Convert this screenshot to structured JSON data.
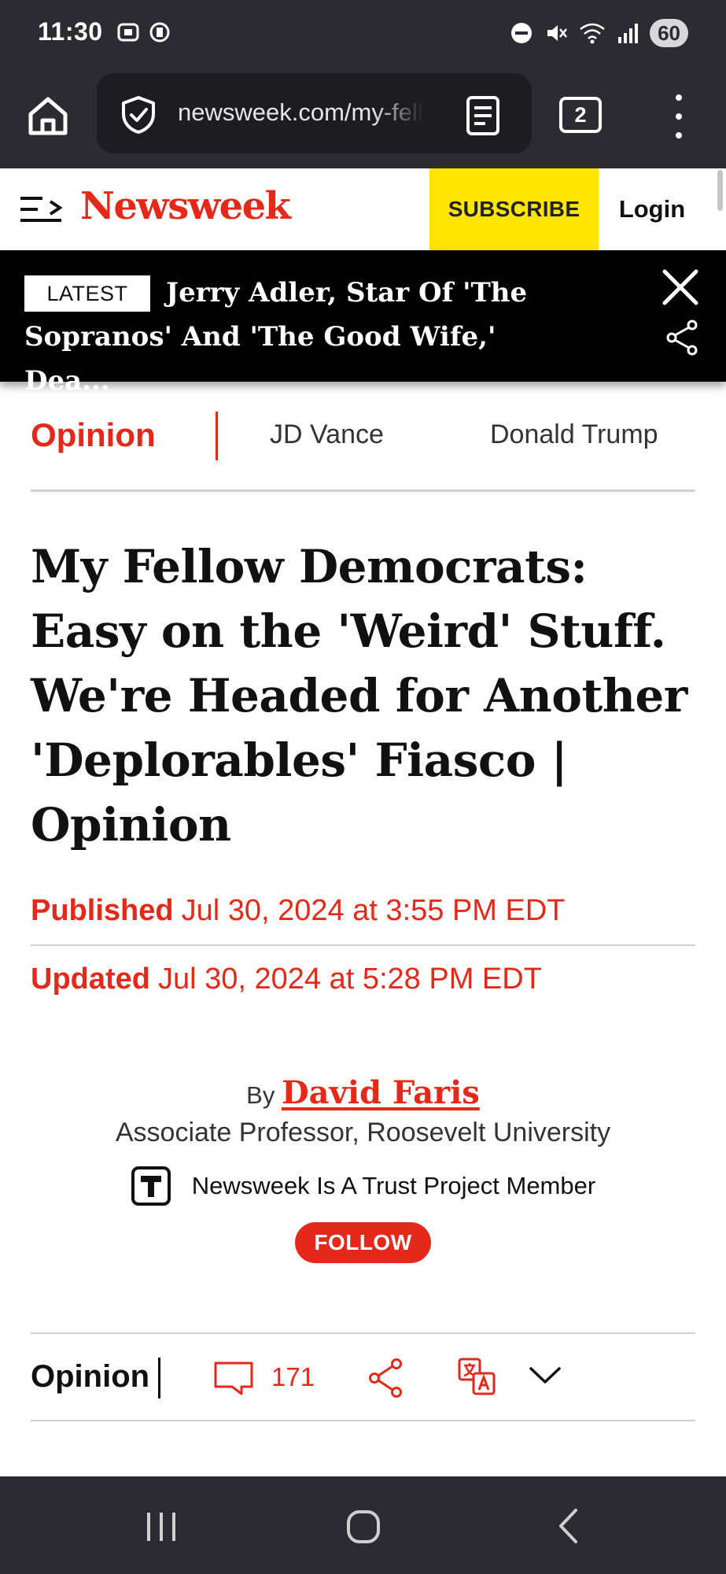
{
  "status_bar": {
    "time": "11:30",
    "battery": "60"
  },
  "browser": {
    "url": "newsweek.com/my-fellow-democrats",
    "tab_count": "2"
  },
  "site_header": {
    "logo": "Newsweek",
    "subscribe_label": "SUBSCRIBE",
    "login_label": "Login"
  },
  "latest_banner": {
    "badge": "LATEST",
    "headline": "Jerry Adler, Star Of 'The Sopranos' And 'The Good Wife,' Dea..."
  },
  "topic_nav": {
    "section": "Opinion",
    "topics": [
      "JD Vance",
      "Donald Trump"
    ]
  },
  "article": {
    "headline": "My Fellow Democrats: Easy on the 'Weird' Stuff. We're Headed for Another 'Deplorables' Fiasco | Opinion",
    "published_label": "Published",
    "published_date": "Jul 30, 2024 at 3:55 PM EDT",
    "updated_label": "Updated",
    "updated_date": "Jul 30, 2024 at 5:28 PM EDT",
    "by_label": "By",
    "author": "David Faris",
    "author_title": "Associate Professor, Roosevelt University",
    "trust_text": "Newsweek Is A Trust Project Member",
    "follow_label": "FOLLOW"
  },
  "share_bar": {
    "section": "Opinion",
    "comment_count": "171"
  },
  "colors": {
    "brand_red": "#e4291a",
    "subscribe_yellow": "#ffe500",
    "chrome_dark": "#2b2b31"
  },
  "icons": [
    "home-icon",
    "shield-icon",
    "reader-mode-icon",
    "menu-icon",
    "hamburger-icon",
    "close-icon",
    "share-icon",
    "comment-icon",
    "translate-icon",
    "chevron-down-icon",
    "trust-project-icon"
  ]
}
